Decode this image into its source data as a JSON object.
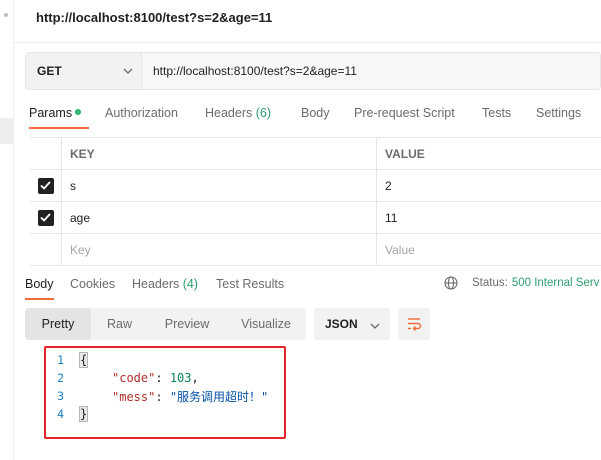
{
  "request": {
    "title": "http://localhost:8100/test?s=2&age=11",
    "method": "GET",
    "url": "http://localhost:8100/test?s=2&age=11"
  },
  "request_tabs": {
    "params": "Params",
    "authorization": "Authorization",
    "headers": "Headers",
    "headers_count": "(6)",
    "body": "Body",
    "prerequest": "Pre-request Script",
    "tests": "Tests",
    "settings": "Settings"
  },
  "params_table": {
    "key_header": "KEY",
    "value_header": "VALUE",
    "rows": [
      {
        "key": "s",
        "value": "2",
        "checked": true
      },
      {
        "key": "age",
        "value": "11",
        "checked": true
      }
    ],
    "key_placeholder": "Key",
    "value_placeholder": "Value"
  },
  "response_tabs": {
    "body": "Body",
    "cookies": "Cookies",
    "headers": "Headers",
    "headers_count": "(4)",
    "test_results": "Test Results"
  },
  "response_status": {
    "label": "Status:",
    "code": "500 Internal Serv"
  },
  "view_modes": [
    "Pretty",
    "Raw",
    "Preview",
    "Visualize"
  ],
  "format": "JSON",
  "response_body": {
    "line_numbers": [
      "1",
      "2",
      "3",
      "4"
    ],
    "open_brace": "{",
    "close_brace": "}",
    "code_key": "\"code\"",
    "code_value": "103",
    "mess_key": "\"mess\"",
    "mess_value": "\"服务调用超时！\""
  },
  "colors": {
    "accent": "#f26b3a",
    "success": "#2e9c6e",
    "highlight_box": "#e8232a"
  }
}
